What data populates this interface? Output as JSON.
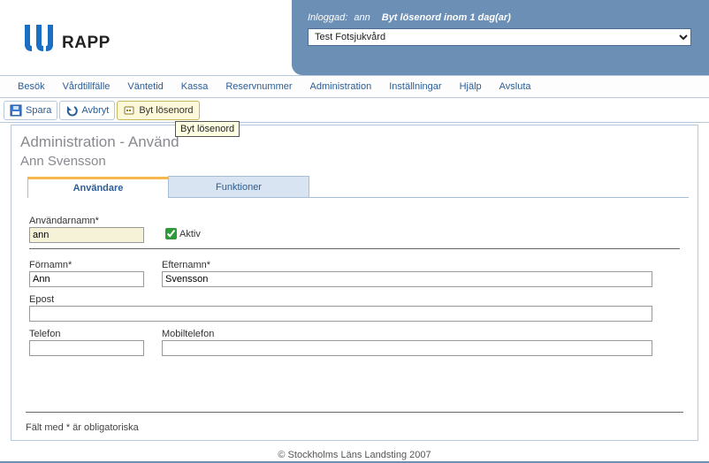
{
  "header": {
    "app_name": "RAPP",
    "logged_in_label": "Inloggad:",
    "username": "ann",
    "warning": "Byt lösenord inom 1 dag(ar)",
    "org_selected": "Test Fotsjukvård"
  },
  "menu": {
    "items": [
      "Besök",
      "Vårdtillfälle",
      "Väntetid",
      "Kassa",
      "Reservnummer",
      "Administration",
      "Inställningar",
      "Hjälp",
      "Avsluta"
    ]
  },
  "toolbar": {
    "save": "Spara",
    "cancel": "Avbryt",
    "changepw": "Byt lösenord"
  },
  "tooltip": "Byt lösenord",
  "page": {
    "title": "Administration - Använd",
    "subtitle": "Ann Svensson"
  },
  "tabs": {
    "user": "Användare",
    "functions": "Funktioner"
  },
  "form": {
    "username_label": "Användarnamn*",
    "username_value": "ann",
    "active_label": "Aktiv",
    "active_checked": true,
    "firstname_label": "Förnamn*",
    "firstname_value": "Ann",
    "lastname_label": "Efternamn*",
    "lastname_value": "Svensson",
    "email_label": "Epost",
    "email_value": "",
    "phone_label": "Telefon",
    "phone_value": "",
    "mobile_label": "Mobiltelefon",
    "mobile_value": "",
    "required_note": "Fält med * är obligatoriska"
  },
  "footer": "© Stockholms Läns Landsting 2007"
}
